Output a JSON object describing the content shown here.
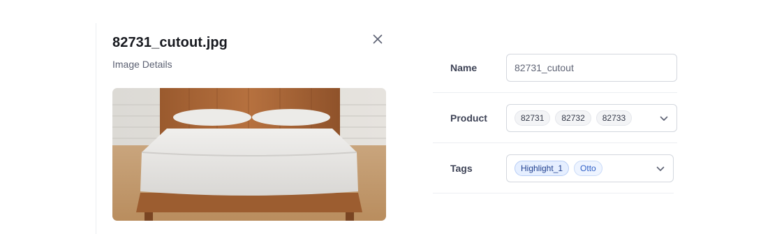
{
  "panel": {
    "filename": "82731_cutout.jpg",
    "subtitle": "Image Details",
    "close_icon": "close-icon"
  },
  "preview_image": {
    "subject": "wooden platform bed with white bedding",
    "icon": "photo"
  },
  "form": {
    "name": {
      "label": "Name",
      "value": "82731_cutout"
    },
    "product": {
      "label": "Product",
      "chips": [
        "82731",
        "82732",
        "82733"
      ],
      "dropdown_icon": "chevron-down-icon"
    },
    "tags": {
      "label": "Tags",
      "chips": [
        "Highlight_1",
        "Otto"
      ],
      "dropdown_icon": "chevron-down-icon"
    }
  },
  "colors": {
    "tag_blue": "#e6efff",
    "tag_blue_border": "#b7cdf6",
    "field_border": "#d3d7de",
    "divider": "#eceef2"
  }
}
